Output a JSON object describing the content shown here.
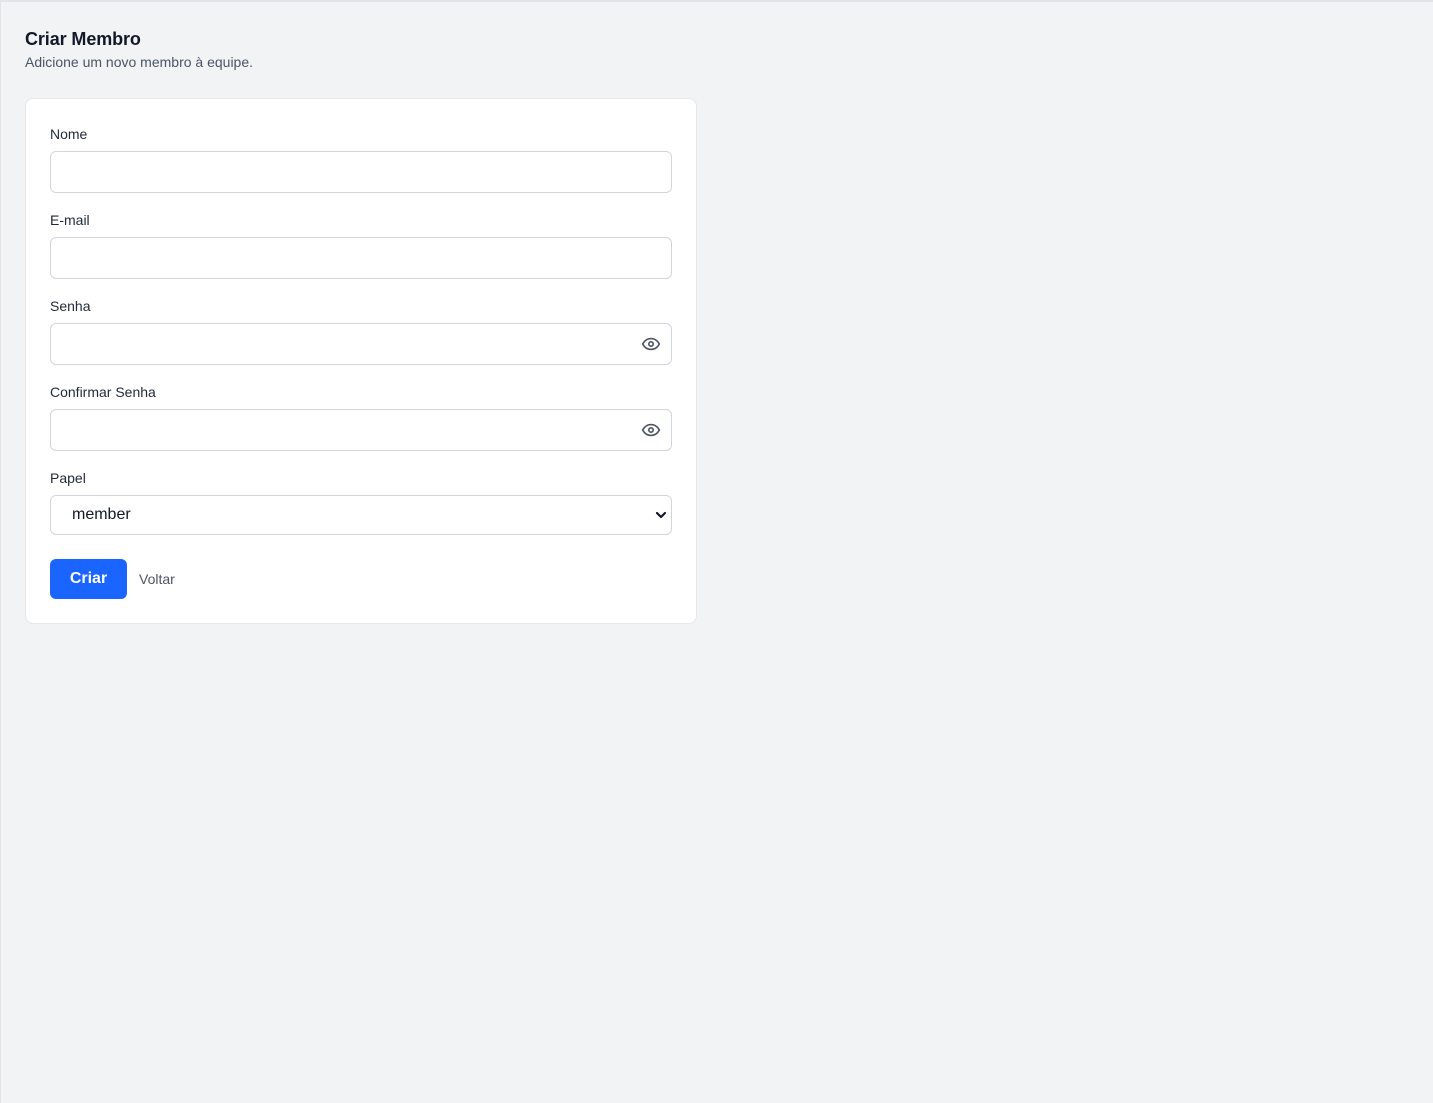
{
  "header": {
    "title": "Criar Membro",
    "subtitle": "Adicione um novo membro à equipe."
  },
  "form": {
    "name": {
      "label": "Nome",
      "value": "",
      "placeholder": ""
    },
    "email": {
      "label": "E-mail",
      "value": "",
      "placeholder": ""
    },
    "password": {
      "label": "Senha",
      "value": "",
      "placeholder": "",
      "toggle_icon": "eye-icon"
    },
    "confirm_password": {
      "label": "Confirmar Senha",
      "value": "",
      "placeholder": "",
      "toggle_icon": "eye-icon"
    },
    "role": {
      "label": "Papel",
      "selected": "member",
      "dropdown_icon": "chevron-down-icon"
    }
  },
  "actions": {
    "submit_label": "Criar",
    "back_label": "Voltar"
  },
  "colors": {
    "background": "#f2f3f5",
    "card": "#ffffff",
    "primary": "#1a64ff",
    "text": "#111827",
    "muted": "#4b5563",
    "border": "#d1d5db"
  }
}
